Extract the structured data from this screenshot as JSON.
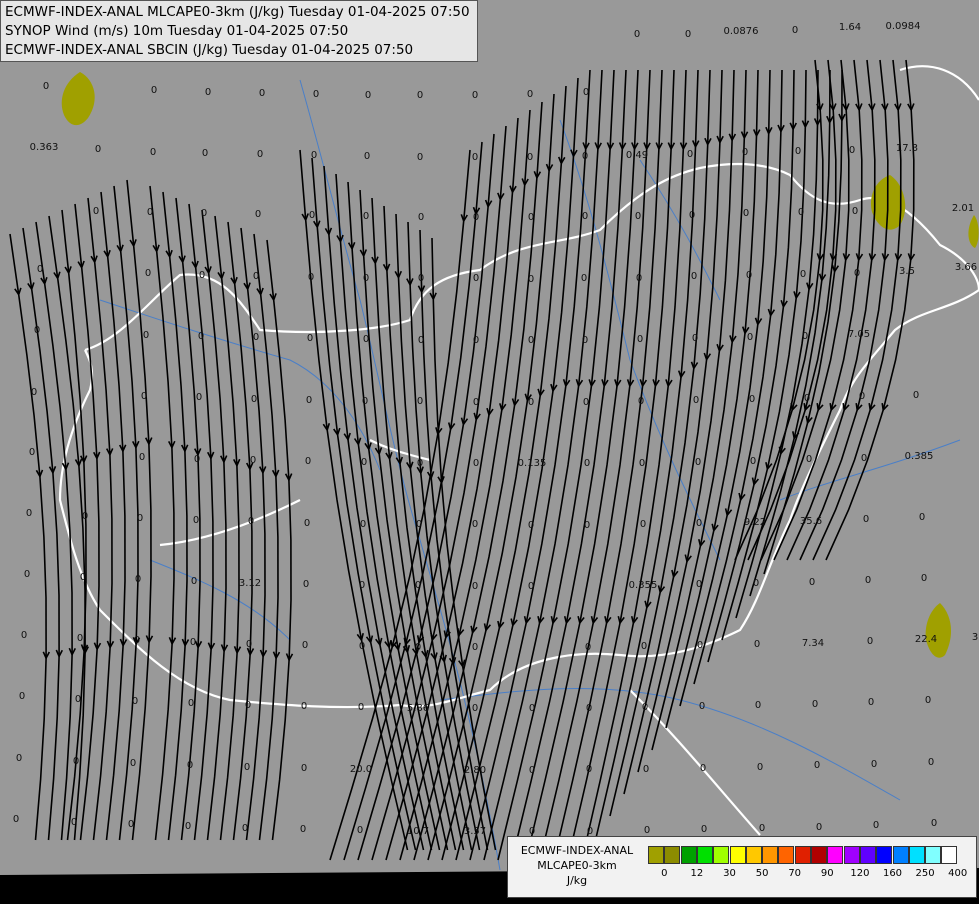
{
  "titles": [
    "ECMWF-INDEX-ANAL MLCAPE0-3km (J/kg) Tuesday 01-04-2025 07:50",
    "SYNOP Wind (m/s) 10m Tuesday 01-04-2025 07:50",
    "ECMWF-INDEX-ANAL SBCIN (J/kg) Tuesday 01-04-2025 07:50"
  ],
  "legend": {
    "title_lines": [
      "ECMWF-INDEX-ANAL",
      "MLCAPE0-3km",
      "J/kg"
    ],
    "colors": [
      "#a0a000",
      "#8c8c00",
      "#00a000",
      "#00e000",
      "#a0ff00",
      "#ffff00",
      "#ffc800",
      "#ff9600",
      "#ff6400",
      "#e02000",
      "#b00000",
      "#ff00ff",
      "#a000ff",
      "#6000ff",
      "#0000ff",
      "#0080ff",
      "#00e0ff",
      "#80ffff",
      "#ffffff"
    ],
    "ticks": [
      "0",
      "12",
      "30",
      "50",
      "70",
      "90",
      "120",
      "160",
      "250",
      "400"
    ]
  },
  "map_colors": {
    "background": "#999999",
    "border": "#ffffff",
    "river": "#4a7fc8",
    "cape_fill": "#a0a000",
    "streamline": "#000000"
  },
  "value_labels": [
    {
      "v": "0",
      "lon": 46,
      "lat": 89
    },
    {
      "v": "0",
      "lon": 154,
      "lat": 93
    },
    {
      "v": "0",
      "lon": 208,
      "lat": 95
    },
    {
      "v": "0",
      "lon": 262,
      "lat": 96
    },
    {
      "v": "0",
      "lon": 316,
      "lat": 97
    },
    {
      "v": "0",
      "lon": 368,
      "lat": 98
    },
    {
      "v": "0",
      "lon": 420,
      "lat": 98
    },
    {
      "v": "0",
      "lon": 475,
      "lat": 98
    },
    {
      "v": "0",
      "lon": 530,
      "lat": 97
    },
    {
      "v": "0",
      "lon": 586,
      "lat": 95
    },
    {
      "v": "0",
      "lon": 637,
      "lat": 37
    },
    {
      "v": "0",
      "lon": 688,
      "lat": 37
    },
    {
      "v": "0.0876",
      "lon": 741,
      "lat": 34
    },
    {
      "v": "0",
      "lon": 795,
      "lat": 33
    },
    {
      "v": "1.64",
      "lon": 850,
      "lat": 30
    },
    {
      "v": "0.0984",
      "lon": 903,
      "lat": 29
    },
    {
      "v": "0.363",
      "lon": 44,
      "lat": 150
    },
    {
      "v": "0",
      "lon": 98,
      "lat": 152
    },
    {
      "v": "0",
      "lon": 153,
      "lat": 155
    },
    {
      "v": "0",
      "lon": 205,
      "lat": 156
    },
    {
      "v": "0",
      "lon": 260,
      "lat": 157
    },
    {
      "v": "0",
      "lon": 314,
      "lat": 158
    },
    {
      "v": "0",
      "lon": 367,
      "lat": 159
    },
    {
      "v": "0",
      "lon": 420,
      "lat": 160
    },
    {
      "v": "0",
      "lon": 475,
      "lat": 160
    },
    {
      "v": "0",
      "lon": 530,
      "lat": 160
    },
    {
      "v": "0",
      "lon": 585,
      "lat": 159
    },
    {
      "v": "0.49",
      "lon": 637,
      "lat": 158
    },
    {
      "v": "0",
      "lon": 690,
      "lat": 157
    },
    {
      "v": "0",
      "lon": 745,
      "lat": 155
    },
    {
      "v": "0",
      "lon": 798,
      "lat": 154
    },
    {
      "v": "0",
      "lon": 852,
      "lat": 153
    },
    {
      "v": "17.3",
      "lon": 907,
      "lat": 151
    },
    {
      "v": "0",
      "lon": 96,
      "lat": 214
    },
    {
      "v": "0",
      "lon": 150,
      "lat": 215
    },
    {
      "v": "0",
      "lon": 204,
      "lat": 216
    },
    {
      "v": "0",
      "lon": 258,
      "lat": 217
    },
    {
      "v": "0",
      "lon": 312,
      "lat": 218
    },
    {
      "v": "0",
      "lon": 366,
      "lat": 219
    },
    {
      "v": "0",
      "lon": 421,
      "lat": 220
    },
    {
      "v": "0",
      "lon": 476,
      "lat": 220
    },
    {
      "v": "0",
      "lon": 531,
      "lat": 220
    },
    {
      "v": "0",
      "lon": 585,
      "lat": 219
    },
    {
      "v": "0",
      "lon": 638,
      "lat": 219
    },
    {
      "v": "0",
      "lon": 692,
      "lat": 218
    },
    {
      "v": "0",
      "lon": 746,
      "lat": 216
    },
    {
      "v": "0",
      "lon": 801,
      "lat": 215
    },
    {
      "v": "0",
      "lon": 855,
      "lat": 214
    },
    {
      "v": "2.01",
      "lon": 963,
      "lat": 211
    },
    {
      "v": "0",
      "lon": 40,
      "lat": 272
    },
    {
      "v": "0",
      "lon": 148,
      "lat": 276
    },
    {
      "v": "0",
      "lon": 202,
      "lat": 278
    },
    {
      "v": "0",
      "lon": 256,
      "lat": 279
    },
    {
      "v": "0",
      "lon": 311,
      "lat": 280
    },
    {
      "v": "0",
      "lon": 366,
      "lat": 281
    },
    {
      "v": "0",
      "lon": 421,
      "lat": 281
    },
    {
      "v": "0",
      "lon": 476,
      "lat": 281
    },
    {
      "v": "0",
      "lon": 531,
      "lat": 282
    },
    {
      "v": "0",
      "lon": 584,
      "lat": 281
    },
    {
      "v": "0",
      "lon": 639,
      "lat": 281
    },
    {
      "v": "0",
      "lon": 694,
      "lat": 279
    },
    {
      "v": "0",
      "lon": 749,
      "lat": 278
    },
    {
      "v": "0",
      "lon": 803,
      "lat": 277
    },
    {
      "v": "0",
      "lon": 857,
      "lat": 276
    },
    {
      "v": "3.5",
      "lon": 907,
      "lat": 274
    },
    {
      "v": "3.66",
      "lon": 966,
      "lat": 270
    },
    {
      "v": "0",
      "lon": 37,
      "lat": 333
    },
    {
      "v": "0",
      "lon": 146,
      "lat": 338
    },
    {
      "v": "0",
      "lon": 201,
      "lat": 339
    },
    {
      "v": "0",
      "lon": 256,
      "lat": 340
    },
    {
      "v": "0",
      "lon": 310,
      "lat": 341
    },
    {
      "v": "0",
      "lon": 366,
      "lat": 342
    },
    {
      "v": "0",
      "lon": 421,
      "lat": 343
    },
    {
      "v": "0",
      "lon": 476,
      "lat": 343
    },
    {
      "v": "0",
      "lon": 531,
      "lat": 343
    },
    {
      "v": "0",
      "lon": 585,
      "lat": 343
    },
    {
      "v": "0",
      "lon": 640,
      "lat": 342
    },
    {
      "v": "0",
      "lon": 695,
      "lat": 341
    },
    {
      "v": "0",
      "lon": 750,
      "lat": 340
    },
    {
      "v": "0",
      "lon": 805,
      "lat": 339
    },
    {
      "v": "7.05",
      "lon": 859,
      "lat": 337
    },
    {
      "v": "0",
      "lon": 34,
      "lat": 395
    },
    {
      "v": "0",
      "lon": 144,
      "lat": 399
    },
    {
      "v": "0",
      "lon": 199,
      "lat": 400
    },
    {
      "v": "0",
      "lon": 254,
      "lat": 402
    },
    {
      "v": "0",
      "lon": 309,
      "lat": 403
    },
    {
      "v": "0",
      "lon": 365,
      "lat": 404
    },
    {
      "v": "0",
      "lon": 420,
      "lat": 404
    },
    {
      "v": "0",
      "lon": 476,
      "lat": 405
    },
    {
      "v": "0",
      "lon": 531,
      "lat": 405
    },
    {
      "v": "0",
      "lon": 586,
      "lat": 405
    },
    {
      "v": "0",
      "lon": 641,
      "lat": 404
    },
    {
      "v": "0",
      "lon": 696,
      "lat": 403
    },
    {
      "v": "0",
      "lon": 752,
      "lat": 402
    },
    {
      "v": "0",
      "lon": 807,
      "lat": 401
    },
    {
      "v": "0",
      "lon": 862,
      "lat": 399
    },
    {
      "v": "0",
      "lon": 916,
      "lat": 398
    },
    {
      "v": "0",
      "lon": 32,
      "lat": 455
    },
    {
      "v": "0",
      "lon": 142,
      "lat": 460
    },
    {
      "v": "0",
      "lon": 197,
      "lat": 462
    },
    {
      "v": "0",
      "lon": 253,
      "lat": 463
    },
    {
      "v": "0",
      "lon": 308,
      "lat": 464
    },
    {
      "v": "0",
      "lon": 364,
      "lat": 465
    },
    {
      "v": "0",
      "lon": 420,
      "lat": 466
    },
    {
      "v": "0",
      "lon": 476,
      "lat": 466
    },
    {
      "v": "0.135",
      "lon": 532,
      "lat": 466
    },
    {
      "v": "0",
      "lon": 587,
      "lat": 466
    },
    {
      "v": "0",
      "lon": 642,
      "lat": 466
    },
    {
      "v": "0",
      "lon": 698,
      "lat": 465
    },
    {
      "v": "0",
      "lon": 753,
      "lat": 464
    },
    {
      "v": "0",
      "lon": 809,
      "lat": 462
    },
    {
      "v": "0",
      "lon": 864,
      "lat": 461
    },
    {
      "v": "0.385",
      "lon": 919,
      "lat": 459
    },
    {
      "v": "0",
      "lon": 29,
      "lat": 516
    },
    {
      "v": "0",
      "lon": 85,
      "lat": 519
    },
    {
      "v": "0",
      "lon": 140,
      "lat": 521
    },
    {
      "v": "0",
      "lon": 196,
      "lat": 523
    },
    {
      "v": "0",
      "lon": 251,
      "lat": 524
    },
    {
      "v": "0",
      "lon": 307,
      "lat": 526
    },
    {
      "v": "0",
      "lon": 363,
      "lat": 527
    },
    {
      "v": "0",
      "lon": 419,
      "lat": 527
    },
    {
      "v": "0",
      "lon": 475,
      "lat": 527
    },
    {
      "v": "0",
      "lon": 531,
      "lat": 528
    },
    {
      "v": "0",
      "lon": 587,
      "lat": 528
    },
    {
      "v": "0",
      "lon": 643,
      "lat": 527
    },
    {
      "v": "0",
      "lon": 699,
      "lat": 526
    },
    {
      "v": "9.22",
      "lon": 755,
      "lat": 525
    },
    {
      "v": "35.6",
      "lon": 811,
      "lat": 524
    },
    {
      "v": "0",
      "lon": 866,
      "lat": 522
    },
    {
      "v": "0",
      "lon": 922,
      "lat": 520
    },
    {
      "v": "0",
      "lon": 27,
      "lat": 577
    },
    {
      "v": "0",
      "lon": 83,
      "lat": 580
    },
    {
      "v": "0",
      "lon": 138,
      "lat": 582
    },
    {
      "v": "0",
      "lon": 194,
      "lat": 584
    },
    {
      "v": "3.12",
      "lon": 250,
      "lat": 586
    },
    {
      "v": "0",
      "lon": 306,
      "lat": 587
    },
    {
      "v": "0",
      "lon": 362,
      "lat": 588
    },
    {
      "v": "0",
      "lon": 418,
      "lat": 588
    },
    {
      "v": "0",
      "lon": 475,
      "lat": 589
    },
    {
      "v": "0",
      "lon": 531,
      "lat": 589
    },
    {
      "v": "0.355",
      "lon": 643,
      "lat": 588
    },
    {
      "v": "0",
      "lon": 699,
      "lat": 587
    },
    {
      "v": "0",
      "lon": 756,
      "lat": 586
    },
    {
      "v": "0",
      "lon": 812,
      "lat": 585
    },
    {
      "v": "0",
      "lon": 868,
      "lat": 583
    },
    {
      "v": "0",
      "lon": 924,
      "lat": 581
    },
    {
      "v": "0",
      "lon": 24,
      "lat": 638
    },
    {
      "v": "0",
      "lon": 80,
      "lat": 641
    },
    {
      "v": "0",
      "lon": 137,
      "lat": 643
    },
    {
      "v": "0",
      "lon": 193,
      "lat": 645
    },
    {
      "v": "0",
      "lon": 249,
      "lat": 647
    },
    {
      "v": "0",
      "lon": 305,
      "lat": 648
    },
    {
      "v": "0",
      "lon": 362,
      "lat": 649
    },
    {
      "v": "0",
      "lon": 418,
      "lat": 650
    },
    {
      "v": "0",
      "lon": 475,
      "lat": 650
    },
    {
      "v": "0",
      "lon": 588,
      "lat": 650
    },
    {
      "v": "0",
      "lon": 644,
      "lat": 649
    },
    {
      "v": "0",
      "lon": 700,
      "lat": 648
    },
    {
      "v": "0",
      "lon": 757,
      "lat": 647
    },
    {
      "v": "7.34",
      "lon": 813,
      "lat": 646
    },
    {
      "v": "0",
      "lon": 870,
      "lat": 644
    },
    {
      "v": "22.4",
      "lon": 926,
      "lat": 642
    },
    {
      "v": "3",
      "lon": 975,
      "lat": 640
    },
    {
      "v": "0",
      "lon": 22,
      "lat": 699
    },
    {
      "v": "0",
      "lon": 78,
      "lat": 702
    },
    {
      "v": "0",
      "lon": 135,
      "lat": 704
    },
    {
      "v": "0",
      "lon": 191,
      "lat": 706
    },
    {
      "v": "0",
      "lon": 248,
      "lat": 708
    },
    {
      "v": "0",
      "lon": 304,
      "lat": 709
    },
    {
      "v": "0",
      "lon": 361,
      "lat": 710
    },
    {
      "v": "5.86",
      "lon": 418,
      "lat": 711
    },
    {
      "v": "0",
      "lon": 475,
      "lat": 711
    },
    {
      "v": "0",
      "lon": 532,
      "lat": 711
    },
    {
      "v": "0",
      "lon": 589,
      "lat": 711
    },
    {
      "v": "0",
      "lon": 645,
      "lat": 710
    },
    {
      "v": "0",
      "lon": 702,
      "lat": 709
    },
    {
      "v": "0",
      "lon": 758,
      "lat": 708
    },
    {
      "v": "0",
      "lon": 815,
      "lat": 707
    },
    {
      "v": "0",
      "lon": 871,
      "lat": 705
    },
    {
      "v": "0",
      "lon": 928,
      "lat": 703
    },
    {
      "v": "0",
      "lon": 19,
      "lat": 761
    },
    {
      "v": "0",
      "lon": 76,
      "lat": 764
    },
    {
      "v": "0",
      "lon": 133,
      "lat": 766
    },
    {
      "v": "0",
      "lon": 190,
      "lat": 768
    },
    {
      "v": "0",
      "lon": 247,
      "lat": 770
    },
    {
      "v": "0",
      "lon": 304,
      "lat": 771
    },
    {
      "v": "20.0",
      "lon": 361,
      "lat": 772
    },
    {
      "v": "2.80",
      "lon": 475,
      "lat": 773
    },
    {
      "v": "0",
      "lon": 532,
      "lat": 773
    },
    {
      "v": "0",
      "lon": 589,
      "lat": 772
    },
    {
      "v": "0",
      "lon": 646,
      "lat": 772
    },
    {
      "v": "0",
      "lon": 703,
      "lat": 771
    },
    {
      "v": "0",
      "lon": 760,
      "lat": 770
    },
    {
      "v": "0",
      "lon": 817,
      "lat": 768
    },
    {
      "v": "0",
      "lon": 874,
      "lat": 767
    },
    {
      "v": "0",
      "lon": 931,
      "lat": 765
    },
    {
      "v": "0",
      "lon": 16,
      "lat": 822
    },
    {
      "v": "0",
      "lon": 74,
      "lat": 825
    },
    {
      "v": "0",
      "lon": 131,
      "lat": 827
    },
    {
      "v": "0",
      "lon": 188,
      "lat": 829
    },
    {
      "v": "0",
      "lon": 245,
      "lat": 831
    },
    {
      "v": "0",
      "lon": 303,
      "lat": 832
    },
    {
      "v": "0",
      "lon": 360,
      "lat": 833
    },
    {
      "v": "10.7",
      "lon": 418,
      "lat": 834
    },
    {
      "v": "3.57",
      "lon": 475,
      "lat": 834
    },
    {
      "v": "0",
      "lon": 532,
      "lat": 834
    },
    {
      "v": "0",
      "lon": 590,
      "lat": 834
    },
    {
      "v": "0",
      "lon": 647,
      "lat": 833
    },
    {
      "v": "0",
      "lon": 704,
      "lat": 832
    },
    {
      "v": "0",
      "lon": 762,
      "lat": 831
    },
    {
      "v": "0",
      "lon": 819,
      "lat": 830
    },
    {
      "v": "0",
      "lon": 876,
      "lat": 828
    },
    {
      "v": "0",
      "lon": 934,
      "lat": 826
    }
  ]
}
